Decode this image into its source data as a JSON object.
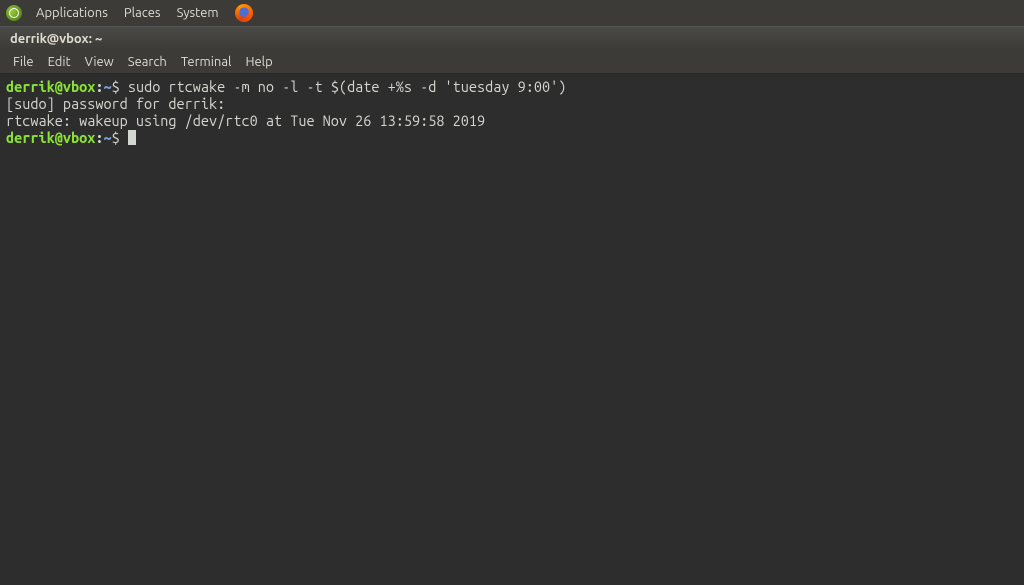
{
  "topPanel": {
    "applications": "Applications",
    "places": "Places",
    "system": "System"
  },
  "window": {
    "title": "derrik@vbox: ~"
  },
  "menubar": {
    "file": "File",
    "edit": "Edit",
    "view": "View",
    "search": "Search",
    "terminal": "Terminal",
    "help": "Help"
  },
  "terminal": {
    "line1": {
      "userhost": "derrik@vbox",
      "colon": ":",
      "path": "~",
      "dollar": "$ ",
      "cmd": "sudo rtcwake -m no -l -t $(date +%s -d 'tuesday 9:00')"
    },
    "line2": "[sudo] password for derrik:",
    "line3": "rtcwake: wakeup using /dev/rtc0 at Tue Nov 26 13:59:58 2019",
    "line4": {
      "userhost": "derrik@vbox",
      "colon": ":",
      "path": "~",
      "dollar": "$ "
    }
  }
}
